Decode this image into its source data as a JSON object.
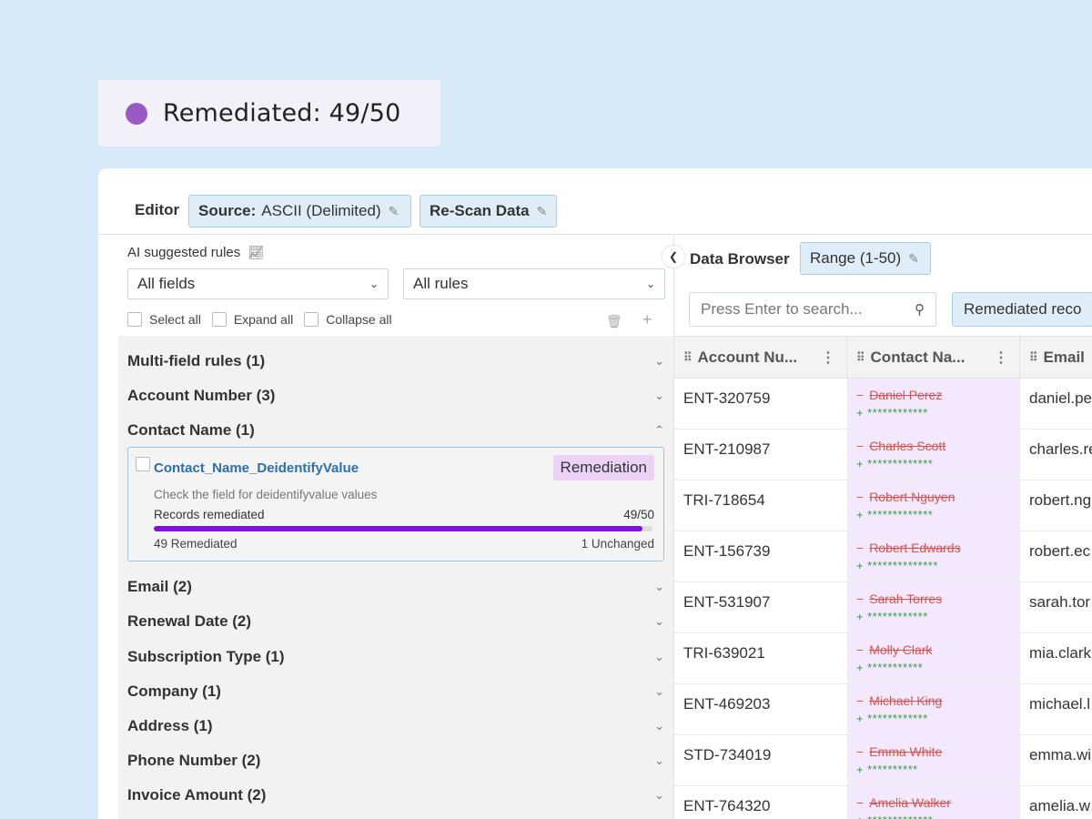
{
  "status": {
    "label": "Remediated: 49/50",
    "dot_color": "#9b59c6"
  },
  "toolbar": {
    "editor_label": "Editor",
    "source_prefix": "Source:",
    "source_value": "ASCII (Delimited)",
    "rescan_label": "Re-Scan Data"
  },
  "rules_panel": {
    "ai_label": "AI suggested rules",
    "field_filter": "All fields",
    "rule_filter": "All rules",
    "select_all": "Select all",
    "expand_all": "Expand all",
    "collapse_all": "Collapse all",
    "groups": [
      "Multi-field rules (1)",
      "Account Number (3)",
      "Contact Name (1)",
      "Email (2)",
      "Renewal Date (2)",
      "Subscription Type (1)",
      "Company (1)",
      "Address (1)",
      "Phone Number (2)",
      "Invoice Amount (2)"
    ],
    "card": {
      "title": "Contact_Name_DeidentifyValue",
      "tag": "Remediation",
      "description": "Check the field for deidentifyvalue values",
      "records_label": "Records remediated",
      "records_value": "49/50",
      "progress_fraction": 0.98,
      "remediated": "49 Remediated",
      "unchanged": "1 Unchanged"
    }
  },
  "data_browser": {
    "label": "Data Browser",
    "range_label": "Range (1-50)",
    "search_placeholder": "Press Enter to search...",
    "filter_chip": "Remediated reco",
    "columns": [
      "Account Nu...",
      "Contact Na...",
      "Email"
    ],
    "rows": [
      {
        "account": "ENT-320759",
        "old": "Daniel Perez",
        "new": "************",
        "email": "daniel.pe"
      },
      {
        "account": "ENT-210987",
        "old": "Charles Scott",
        "new": "*************",
        "email": "charles.re"
      },
      {
        "account": "TRI-718654",
        "old": "Robert Nguyen",
        "new": "*************",
        "email": "robert.ng"
      },
      {
        "account": "ENT-156739",
        "old": "Robert Edwards",
        "new": "**************",
        "email": "robert.ec"
      },
      {
        "account": "ENT-531907",
        "old": "Sarah Torres",
        "new": "************",
        "email": "sarah.tor"
      },
      {
        "account": "TRI-639021",
        "old": "Molly Clark",
        "new": "***********",
        "email": "mia.clark"
      },
      {
        "account": "ENT-469203",
        "old": "Michael King",
        "new": "************",
        "email": "michael.l"
      },
      {
        "account": "STD-734019",
        "old": "Emma White",
        "new": "**********",
        "email": "emma.wi"
      },
      {
        "account": "ENT-764320",
        "old": "Amelia Walker",
        "new": "*************",
        "email": "amelia.w"
      }
    ]
  },
  "colors": {
    "background": "#d8e9f7",
    "chip_fill": "#dfedf8",
    "progress_fill": "#7f12d6",
    "removed_text": "#d9534f",
    "added_text": "#3a9a4a",
    "remediated_column": "#f4e9fc"
  }
}
